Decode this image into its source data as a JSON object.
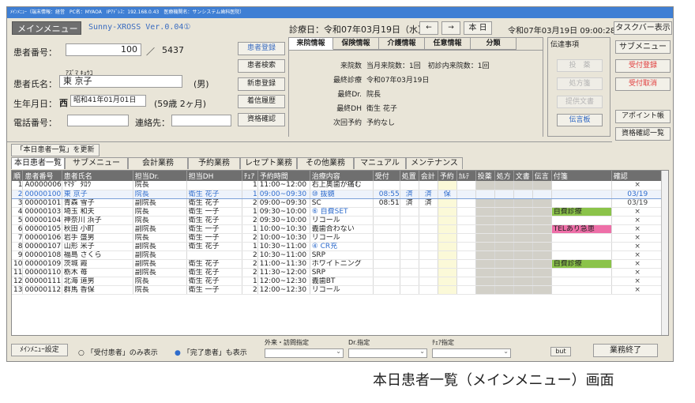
{
  "window_title": "ﾒｲﾝﾒﾆｭｰ（端末情報：経営　PC名：MYAOA　IPｱﾄﾞﾚｽ：192.168.0.43　医療機関名：サンシステム歯科医院）",
  "header": {
    "menu_label": "メインメニュー",
    "app_version": "Sunny-XROSS Ver.0.04①",
    "diag_date": "診療日：令和07年03月19日（水）",
    "prev": "←",
    "next": "→",
    "today": "本 日",
    "current_datetime": "令和07年03月19日 09:00:28",
    "taskbar_button": "タスクバー表示"
  },
  "patient": {
    "no_label": "患者番号：",
    "no_value": "100",
    "no_sep": "／",
    "no_total": "5437",
    "kana": "ｱｽﾞﾏ ｷｮｳｺ",
    "name_label": "患者氏名：",
    "name_value": "東 京子",
    "gender": "(男)",
    "birth_label": "生年月日：",
    "era": "西",
    "birth_value": "昭和41年01月01日",
    "age": "(59歳 2ヶ月)",
    "tel_label": "電話番号：",
    "contact_label": "連絡先："
  },
  "left_buttons": [
    "患者登録",
    "患者検索",
    "新患登録",
    "着信履歴",
    "資格確認"
  ],
  "info_tabs": [
    "来院情報",
    "保険情報",
    "介護情報",
    "任意情報",
    "分類"
  ],
  "info": [
    {
      "k": "来院数",
      "v": "当月来院数：1回　初診内来院数：1回"
    },
    {
      "k": "最終診療",
      "v": "令和07年03月19日"
    },
    {
      "k": "最終Dr.",
      "v": "院長"
    },
    {
      "k": "最終DH",
      "v": "衛生 花子"
    },
    {
      "k": "次回予約",
      "v": "予約なし"
    }
  ],
  "comm": {
    "label": "伝達事項",
    "buttons": [
      "投　薬",
      "処方箋",
      "提供文書",
      "伝言板"
    ]
  },
  "right_buttons": {
    "sub": "サブメニュー",
    "recv": "受付登録",
    "cancel": "受付取消",
    "appoint": "アポイント帳",
    "qual": "資格確認一覧"
  },
  "refresh_label": "「本日患者一覧」を更新",
  "nav_tabs": [
    "本日患者一覧",
    "サブメニュー",
    "会計業務",
    "予約業務",
    "レセプト業務",
    "その他業務",
    "マニュアル",
    "メンテナンス"
  ],
  "table": {
    "headers": [
      "順",
      "患者番号",
      "患者氏名",
      "担当Dr.",
      "担当DH",
      "ﾁｪｱ",
      "予約時間",
      "治療内容",
      "受付",
      "処置",
      "会計",
      "予約",
      "ｶﾙﾃ",
      "投薬",
      "処方",
      "文書",
      "伝言",
      "付箋",
      "確認"
    ],
    "rows": [
      [
        "1",
        "A0000006",
        "ﾔﾏﾀﾞ ﾀﾛｳ",
        "院長",
        "",
        "1",
        "11:00~12:00",
        "右上奥歯が痛む",
        "",
        "",
        "",
        "",
        "",
        "",
        "",
        "",
        "",
        "",
        "×"
      ],
      [
        "2",
        "00000100",
        "東 京子",
        "院長",
        "衛生 花子",
        "1",
        "09:00~09:30",
        "⑩ 抜髄",
        "08:55",
        "済",
        "済",
        "保",
        "",
        "",
        "",
        "",
        "",
        "",
        "03/19"
      ],
      [
        "3",
        "00000101",
        "青森 雪子",
        "副院長",
        "衛生 花子",
        "2",
        "09:00~09:30",
        "SC",
        "08:51",
        "済",
        "済",
        "",
        "",
        "",
        "",
        "",
        "",
        "",
        "03/19"
      ],
      [
        "4",
        "00000103",
        "埼玉 和夫",
        "院長",
        "衛生 一子",
        "1",
        "09:30~10:00",
        "⑥ 自費SET",
        "",
        "",
        "",
        "",
        "",
        "",
        "",
        "",
        "",
        "自費診療",
        "×"
      ],
      [
        "5",
        "00000104",
        "神奈川 浜子",
        "院長",
        "衛生 花子",
        "2",
        "09:30~10:00",
        "リコール",
        "",
        "",
        "",
        "",
        "",
        "",
        "",
        "",
        "",
        "",
        "×"
      ],
      [
        "6",
        "00000105",
        "秋田 小町",
        "副院長",
        "衛生 一子",
        "1",
        "10:00~10:30",
        "義歯合わない",
        "",
        "",
        "",
        "",
        "",
        "",
        "",
        "",
        "",
        "TELあり急患",
        "×"
      ],
      [
        "7",
        "00000106",
        "岩手 盛男",
        "院長",
        "衛生 一子",
        "2",
        "10:00~10:30",
        "リコール",
        "",
        "",
        "",
        "",
        "",
        "",
        "",
        "",
        "",
        "",
        "×"
      ],
      [
        "8",
        "00000107",
        "山形 米子",
        "副院長",
        "衛生 花子",
        "1",
        "10:30~11:00",
        "④ CR充",
        "",
        "",
        "",
        "",
        "",
        "",
        "",
        "",
        "",
        "",
        "×"
      ],
      [
        "9",
        "00000108",
        "福島 さくら",
        "副院長",
        "",
        "2",
        "10:30~11:00",
        "SRP",
        "",
        "",
        "",
        "",
        "",
        "",
        "",
        "",
        "",
        "",
        "×"
      ],
      [
        "10",
        "00000109",
        "茨城 霞",
        "副院長",
        "衛生 花子",
        "2",
        "11:00~11:30",
        "ホワイトニング",
        "",
        "",
        "",
        "",
        "",
        "",
        "",
        "",
        "",
        "自費診療",
        "×"
      ],
      [
        "11",
        "00000110",
        "栃木 苺",
        "副院長",
        "衛生 花子",
        "2",
        "11:30~12:00",
        "SRP",
        "",
        "",
        "",
        "",
        "",
        "",
        "",
        "",
        "",
        "",
        "×"
      ],
      [
        "12",
        "00000111",
        "北海 道男",
        "院長",
        "衛生 花子",
        "1",
        "12:00~12:30",
        "義歯BT",
        "",
        "",
        "",
        "",
        "",
        "",
        "",
        "",
        "",
        "",
        "×"
      ],
      [
        "13",
        "00000112",
        "群馬 香保",
        "院長",
        "衛生 一子",
        "2",
        "12:00~12:30",
        "リコール",
        "",
        "",
        "",
        "",
        "",
        "",
        "",
        "",
        "",
        "",
        "×"
      ]
    ]
  },
  "footer": {
    "settings": "ﾒｲﾝﾒﾆｭｰ設定",
    "radio1": "「受付患者」のみ表示",
    "radio2": "「完了患者」も表示",
    "filter1": "外来・訪問指定",
    "filter2": "Dr.指定",
    "filter3": "ﾁｪｱ指定",
    "but": "but",
    "exit": "業務終了"
  },
  "caption": "本日患者一覧（メインメニュー）画面",
  "colors": {
    "title": "#3f7fd4",
    "highlight_blue": "#2f6ccc",
    "green_tag": "#8bc34a",
    "pink_tag": "#ee6fa8",
    "red": "#e03c3c"
  }
}
